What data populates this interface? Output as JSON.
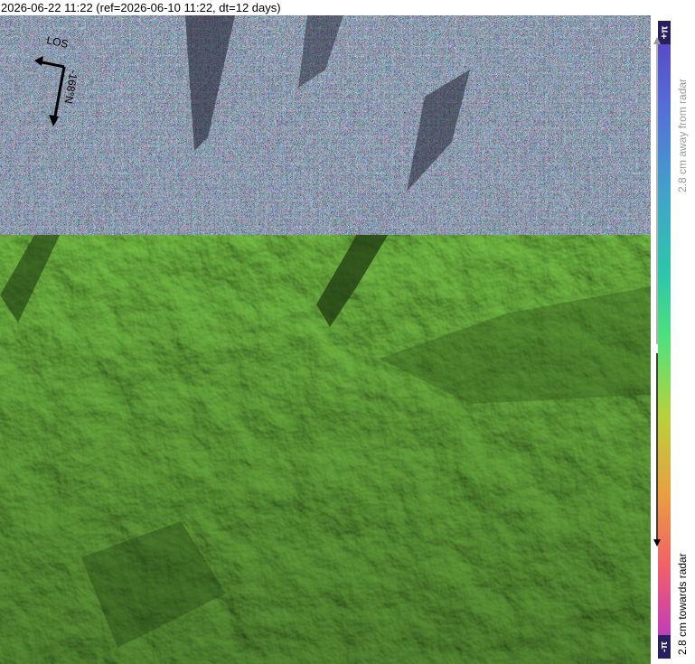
{
  "title": "2026-06-22 11:22 (ref=2026-06-10 11:22, dt=12 days)",
  "map": {
    "los_label": "LOS",
    "heading_label": "-168°N",
    "colors": {
      "decorrelated_noise": [
        "#c45a8a",
        "#5a7ad2",
        "#7ac45a",
        "#d2a05a",
        "#8a5ac4"
      ],
      "terrain_green": "#7fd04a",
      "terrain_shadow": "#1f3a12",
      "arrow": "#000000"
    }
  },
  "colorbar": {
    "top_symbol": "+π",
    "bottom_symbol": "-π",
    "away_label": "2.8 cm away from radar",
    "towards_label": "2.8 cm towards radar",
    "colors": [
      "#5a3fbf",
      "#5470d8",
      "#3fa6c9",
      "#2dc7a8",
      "#4fe27a",
      "#b7d23a",
      "#e9a040",
      "#f25d6a",
      "#c23fb8"
    ]
  }
}
